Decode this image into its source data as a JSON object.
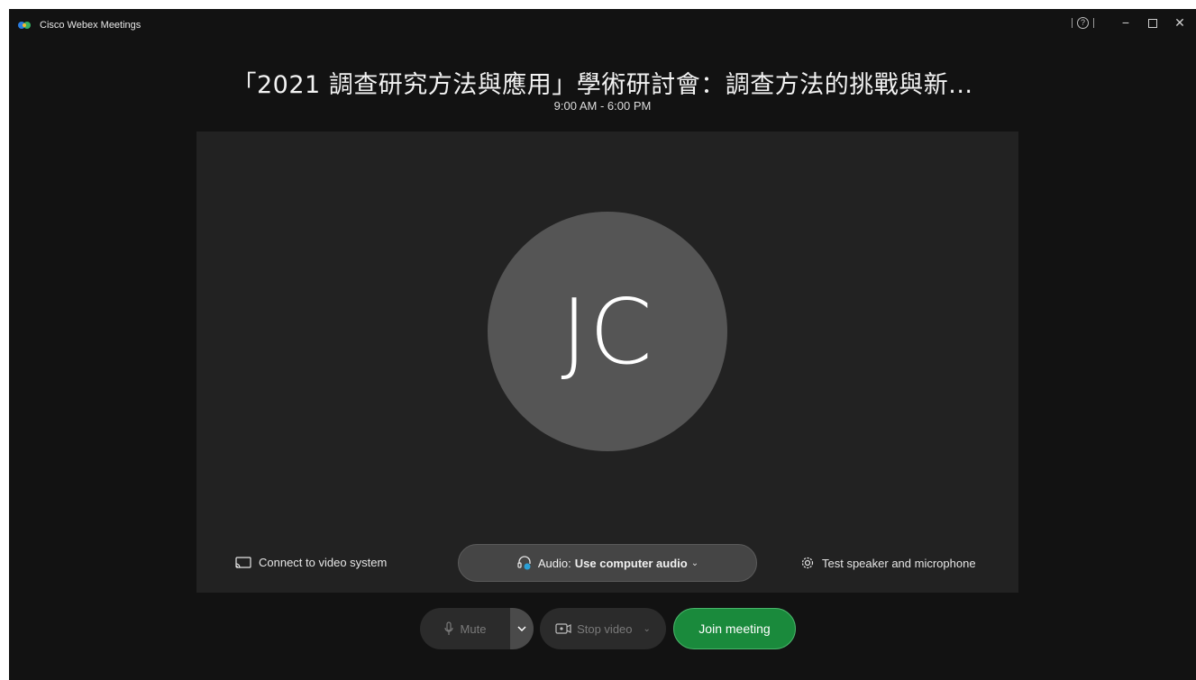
{
  "app": {
    "title": "Cisco Webex Meetings"
  },
  "window_controls": {
    "help": "?",
    "minimize": "−",
    "close": "✕"
  },
  "meeting": {
    "title": "「2021 調查研究方法與應用」學術研討會：調查方法的挑戰與新...",
    "time": "9:00 AM - 6:00 PM"
  },
  "preview": {
    "avatar_initials": "JC",
    "connect_video_label": "Connect to video system",
    "audio_prefix": "Audio:",
    "audio_value": "Use computer audio",
    "test_label": "Test speaker and microphone"
  },
  "controls": {
    "mute_label": "Mute",
    "stop_video_label": "Stop video",
    "join_label": "Join meeting"
  },
  "colors": {
    "background": "#121212",
    "preview_bg": "#222222",
    "avatar_bg": "#555555",
    "join_green": "#1a8a3c",
    "audio_icon_blue": "#2a9fd6"
  }
}
